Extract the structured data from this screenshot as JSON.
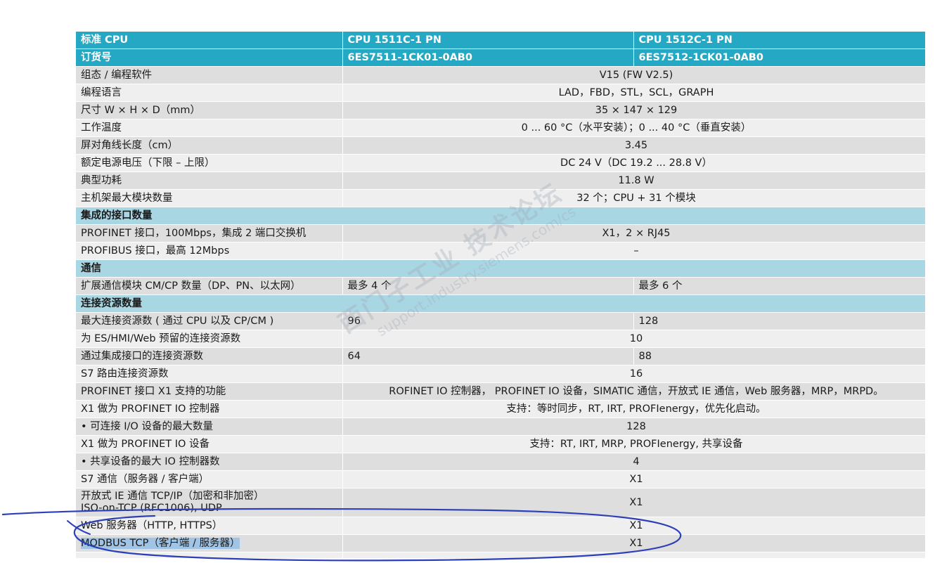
{
  "headers": {
    "label": "标准 CPU",
    "col1": "CPU 1511C-1 PN",
    "col2": "CPU 1512C-1 PN"
  },
  "order": {
    "label": "订货号",
    "col1": "6ES7511-1CK01-0AB0",
    "col2": "6ES7512-1CK01-0AB0"
  },
  "general_rows": [
    {
      "label": "组态 / 编程软件",
      "value": "V15 (FW V2.5)"
    },
    {
      "label": "编程语言",
      "value": "LAD，FBD，STL，SCL，GRAPH"
    },
    {
      "label": "尺寸 W × H × D（mm）",
      "value": "35 × 147 × 129"
    },
    {
      "label": "工作温度",
      "value": "0 ... 60 °C（水平安装）；0 ... 40 °C（垂直安装）"
    },
    {
      "label": "屏对角线长度（cm）",
      "value": "3.45"
    },
    {
      "label": "额定电源电压（下限 – 上限）",
      "value": "DC 24 V（DC 19.2 ... 28.8 V）"
    },
    {
      "label": "典型功耗",
      "value": "11.8 W"
    },
    {
      "label": "主机架最大模块数量",
      "value": "32 个；CPU + 31 个模块"
    }
  ],
  "sections": {
    "interfaces": "集成的接口数量",
    "communication": "通信",
    "connections": "连接资源数量"
  },
  "interface_rows": [
    {
      "label": "PROFINET 接口，100Mbps，集成 2 端口交换机",
      "value": "X1，2 × RJ45"
    },
    {
      "label": "PROFIBUS 接口，最高 12Mbps",
      "value": "–"
    }
  ],
  "comm_row": {
    "label": "扩展通信模块 CM/CP 数量（DP、PN、以太网）",
    "col1": "最多 4 个",
    "col2": "最多 6 个"
  },
  "connection_rows": {
    "max": {
      "label": "最大连接资源数 ( 通过 CPU 以及 CP/CM )",
      "col1": "96",
      "col2": "128"
    },
    "reserved": {
      "label": "为 ES/HMI/Web 预留的连接资源数",
      "value": "10"
    },
    "integrated": {
      "label": "通过集成接口的连接资源数",
      "col1": "64",
      "col2": "88"
    },
    "s7routing": {
      "label": "S7 路由连接资源数",
      "value": "16"
    }
  },
  "function_rows": [
    {
      "label": "PROFINET 接口 X1 支持的功能",
      "value": "ROFINET IO 控制器， PROFINET IO 设备，SIMATIC 通信，开放式 IE 通信，Web 服务器，MRP，MRPD。"
    },
    {
      "label": "X1 做为 PROFINET IO 控制器",
      "value": "支持：等时同步，RT, IRT, PROFIenergy，优先化启动。"
    },
    {
      "label": "• 可连接 I/O 设备的最大数量",
      "value": "128"
    },
    {
      "label": "X1 做为 PROFINET IO 设备",
      "value": "支持：RT, IRT, MRP, PROFIenergy, 共享设备"
    },
    {
      "label": "• 共享设备的最大 IO 控制器数",
      "value": "4"
    },
    {
      "label": "S7 通信（服务器 / 客户端）",
      "value": "X1"
    }
  ],
  "open_ie_row": {
    "line1": "开放式 IE 通信 TCP/IP（加密和非加密）",
    "line2": "ISO-on-TCP (RFC1006), UDP",
    "value": "X1"
  },
  "web_row": {
    "label": "Web 服务器（HTTP, HTTPS）",
    "value": "X1"
  },
  "modbus_row": {
    "label": "MODBUS TCP（客户端 / 服务器）",
    "value": "X1"
  },
  "watermark": {
    "line1": "西门子工业 技术论坛",
    "line2": "support.industry.siemens.com/cs"
  },
  "colors": {
    "header_bg": "#25a8c3",
    "section_bg": "#a9d6e3",
    "row_dark": "#dedede",
    "row_light": "#efefef",
    "highlight": "#9fc4e6",
    "annotation_ink": "#2b3fb8"
  }
}
